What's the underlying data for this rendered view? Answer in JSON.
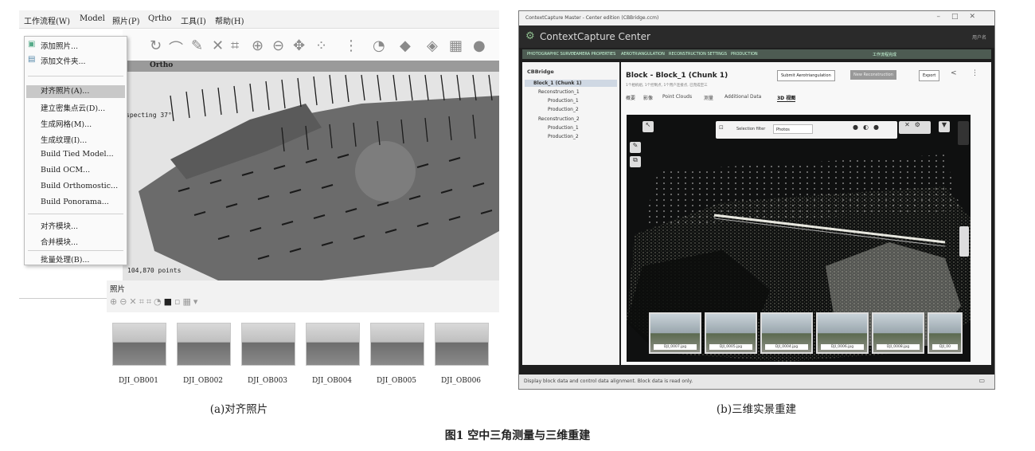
{
  "panel_a": {
    "menubar": [
      "工作流程(W)",
      "Model",
      "照片(P)",
      "Qrtho",
      "工具(I)",
      "帮助(H)"
    ],
    "dropdown": {
      "group1": [
        "添加照片...",
        "添加文件夹..."
      ],
      "group2": [
        "对齐照片(A)...",
        "建立密集点云(D)...",
        "生成网格(M)...",
        "生成纹理(I)...",
        "Build Tied Model...",
        "Build OCM...",
        "Build Orthomostic...",
        "Build Ponorama..."
      ],
      "group3": [
        "对齐模块...",
        "合并模块..."
      ],
      "group4": [
        "批量处理(B)..."
      ]
    },
    "view_tab": "Ortho",
    "viewport_text": "specting 37°",
    "points_label": "104,870 points",
    "photos_title": "照片",
    "thumbnails": [
      "DJI_OB001",
      "DJI_OB002",
      "DJI_OB003",
      "DJI_OB004",
      "DJI_OB005",
      "DJI_OB006"
    ],
    "caption": "(a)对齐照片"
  },
  "panel_b": {
    "window_title": "ContextCapture Master - Center edition (CBBridge.ccm)",
    "app_title": "ContextCapture Center",
    "user_label": "用户名",
    "steps": [
      "PHOTOGRAPHIC SURVEY",
      "CAMERA PROPERTIES",
      "AEROTRIANGULATION",
      "RECONSTRUCTION SETTINGS",
      "PRODUCTION",
      "工作流程完成"
    ],
    "tree": {
      "root": "CBBridge",
      "items": [
        "Block_1 (Chunk 1)",
        "Reconstruction_1",
        "Production_1",
        "Production_2",
        "Reconstruction_2",
        "Production_1",
        "Production_2"
      ]
    },
    "block_title": "Block - Block_1 (Chunk 1)",
    "block_subtitle": "1个相机组, 1个控制点, 1个用户连接点, 已完成空三",
    "buttons": [
      "Submit Aerotriangulation",
      "New Reconstruction",
      "Export"
    ],
    "tabs": [
      "概要",
      "影像",
      "Point Clouds",
      "测量",
      "Additional Data",
      "3D 视图"
    ],
    "selection_filter_label": "Selection filter",
    "selection_filter_value": "Photos",
    "film_labels": [
      "DJI_0007.jpg",
      "DJI_0005.jpg",
      "DJI_0004.jpg",
      "DJI_0006.jpg",
      "DJI_0008.jpg",
      "DJI_00"
    ],
    "status_text": "Display block data and control data alignment. Block data is read only.",
    "caption": "(b)三维实景重建"
  },
  "figure_caption": "图1   空中三角测量与三维重建",
  "colors": {
    "dark_bg": "#1e1e1e",
    "viewport_plane": "#6b6b6b",
    "highlight": "#c8c8c8"
  }
}
